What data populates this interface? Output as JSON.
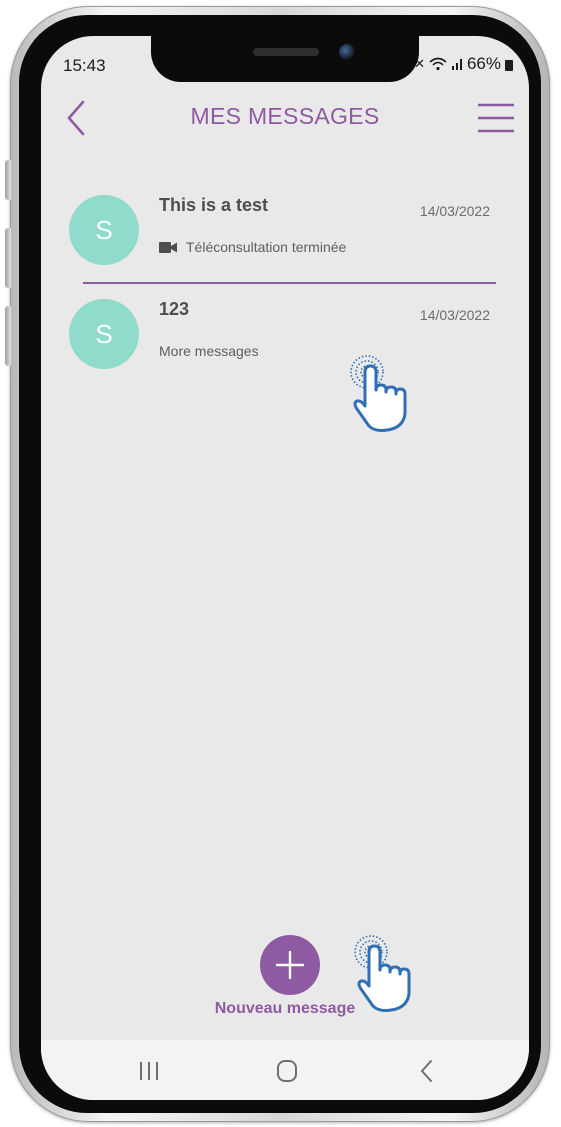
{
  "status_bar": {
    "time": "15:43",
    "battery": "66%",
    "icons": [
      "mute-icon",
      "wifi-icon",
      "signal-icon",
      "battery-icon"
    ]
  },
  "header": {
    "title": "MES MESSAGES",
    "back_icon": "chevron-left-icon",
    "menu_icon": "hamburger-menu-icon"
  },
  "messages": [
    {
      "avatar": "S",
      "title": "This is a test",
      "date": "14/03/2022",
      "preview": "Téléconsultation terminée",
      "preview_icon": "video-camera-icon"
    },
    {
      "avatar": "S",
      "title": "123",
      "date": "14/03/2022",
      "preview": "More messages"
    }
  ],
  "fab": {
    "icon": "plus-icon",
    "label": "Nouveau message"
  },
  "nav_bar": {
    "buttons": [
      "recent-apps-icon",
      "home-icon",
      "back-icon"
    ]
  },
  "colors": {
    "accent": "#8e5aa1",
    "avatar": "#8fdccc",
    "screen_background": "#e9e9e9",
    "tap_hand": "#2f6fb5"
  }
}
